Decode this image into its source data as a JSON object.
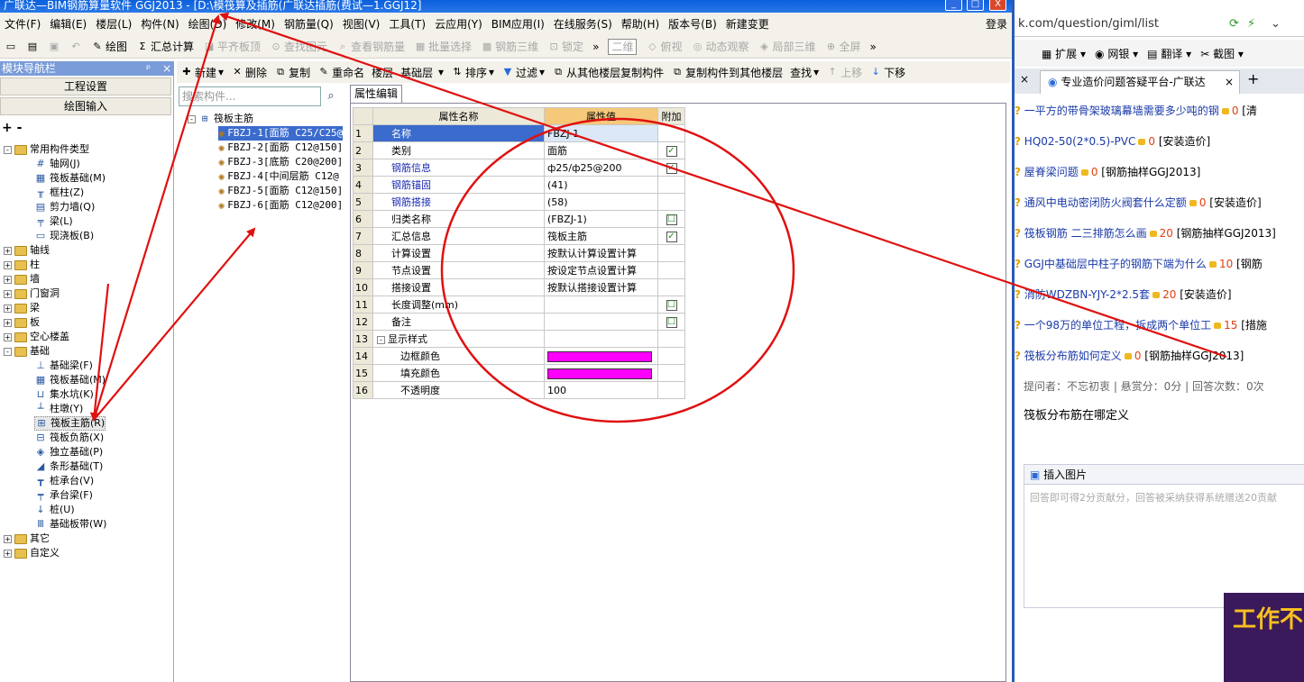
{
  "window": {
    "title": "广联达—BIM钢筋算量软件 GGJ2013 - [D:\\模筏算及插筋(广联达插筋(费试—1.GGJ12]",
    "minimize": "_",
    "maximize": "□",
    "close": "X"
  },
  "menu": [
    "文件(F)",
    "编辑(E)",
    "楼层(L)",
    "构件(N)",
    "绘图(D)",
    "修改(M)",
    "钢筋量(Q)",
    "视图(V)",
    "工具(T)",
    "云应用(Y)",
    "BIM应用(I)",
    "在线服务(S)",
    "帮助(H)",
    "版本号(B)",
    "新建变更"
  ],
  "menu_login": "登录",
  "toolbar1": {
    "draw": "绘图",
    "summary": "汇总计算",
    "flat_board": "平齐板顶",
    "find_elem": "查找图元",
    "view_rebar": "查看钢筋量",
    "batch_select": "批量选择",
    "rebar_3d": "钢筋三维",
    "lock": "锁定",
    "view_mode": "二维",
    "top_view": "俯视",
    "dynamic": "动态观察",
    "local_3d": "局部三维",
    "fullscreen": "全屏"
  },
  "nav": {
    "header": "模块导航栏",
    "pin": "ᵖ",
    "close": "×",
    "btn_project": "工程设置",
    "btn_draw": "绘图输入",
    "tools": "+ -"
  },
  "tree": {
    "common": "常用构件类型",
    "grid": "轴网(J)",
    "raft_found": "筏板基础(M)",
    "column": "框柱(Z)",
    "shear_wall": "剪力墙(Q)",
    "beam": "梁(L)",
    "slab": "现浇板(B)",
    "axis": "轴线",
    "col": "柱",
    "wall": "墙",
    "door": "门窗洞",
    "liang": "梁",
    "ban": "板",
    "hollow": "空心楼盖",
    "foundation": "基础",
    "f_beam": "基础梁(F)",
    "f_raft": "筏板基础(M)",
    "f_pit": "集水坑(K)",
    "f_pier": "柱墩(Y)",
    "f_main": "筏板主筋(R)",
    "f_neg": "筏板负筋(X)",
    "f_indep": "独立基础(P)",
    "f_strip": "条形基础(T)",
    "f_cap": "桩承台(V)",
    "f_capbeam": "承台梁(F)",
    "f_pile": "桩(U)",
    "f_band": "基础板带(W)",
    "other": "其它",
    "custom": "自定义"
  },
  "toolbar2": {
    "new": "新建",
    "delete": "删除",
    "copy": "复制",
    "rename": "重命名",
    "floor_label": "楼层",
    "floor_value": "基础层",
    "sort": "排序",
    "filter": "过滤",
    "copy_from": "从其他楼层复制构件",
    "copy_to": "复制构件到其他楼层",
    "find": "查找",
    "up": "上移",
    "down": "下移"
  },
  "components": {
    "search_placeholder": "搜索构件...",
    "root": "筏板主筋",
    "items": [
      "FBZJ-1[面筋 C25/C25@",
      "FBZJ-2[面筋 C12@150]",
      "FBZJ-3[底筋 C20@200]",
      "FBZJ-4[中间层筋 C12@",
      "FBZJ-5[面筋 C12@150]",
      "FBZJ-6[面筋 C12@200]"
    ]
  },
  "props": {
    "tab": "属性编辑",
    "col_name": "属性名称",
    "col_value": "属性值",
    "col_extra": "附加",
    "rows": [
      {
        "n": "1",
        "name": "名称",
        "value": "FBZJ-1",
        "check": ""
      },
      {
        "n": "2",
        "name": "类别",
        "value": "面筋",
        "check": "✓"
      },
      {
        "n": "3",
        "name": "钢筋信息",
        "value": "ф25/ф25@200",
        "check": "✓"
      },
      {
        "n": "4",
        "name": "钢筋锚固",
        "value": "(41)",
        "check": ""
      },
      {
        "n": "5",
        "name": "钢筋搭接",
        "value": "(58)",
        "check": ""
      },
      {
        "n": "6",
        "name": "归类名称",
        "value": "(FBZJ-1)",
        "check": "☐"
      },
      {
        "n": "7",
        "name": "汇总信息",
        "value": "筏板主筋",
        "check": "✓"
      },
      {
        "n": "8",
        "name": "计算设置",
        "value": "按默认计算设置计算",
        "check": ""
      },
      {
        "n": "9",
        "name": "节点设置",
        "value": "按设定节点设置计算",
        "check": ""
      },
      {
        "n": "10",
        "name": "搭接设置",
        "value": "按默认搭接设置计算",
        "check": ""
      },
      {
        "n": "11",
        "name": "长度调整(mm)",
        "value": "",
        "check": "☐"
      },
      {
        "n": "12",
        "name": "备注",
        "value": "",
        "check": "☐"
      },
      {
        "n": "13",
        "name": "显示样式",
        "value": "",
        "check": ""
      },
      {
        "n": "14",
        "name": "边框颜色",
        "value": "",
        "check": ""
      },
      {
        "n": "15",
        "name": "填充颜色",
        "value": "",
        "check": ""
      },
      {
        "n": "16",
        "name": "不透明度",
        "value": "100",
        "check": ""
      }
    ],
    "swatch_color": "#ff00ff"
  },
  "browser": {
    "address": "k.com/question/giml/list",
    "bookmarks": [
      "扩展",
      "网银",
      "翻译",
      "截图"
    ],
    "tab_title": "专业造价问题答疑平台-广联达",
    "tab_close": "×",
    "new_tab": "+",
    "questions": [
      {
        "title": "一平方的带骨架玻璃幕墙需要多少吨的钢",
        "score": "0",
        "tag": "[清"
      },
      {
        "title": "HQ02-50(2*0.5)-PVC",
        "score": "0",
        "tag": "[安装造价]"
      },
      {
        "title": "屋脊梁问题",
        "score": "0",
        "tag": "[钢筋抽样GGJ2013]"
      },
      {
        "title": "通风中电动密闭防火阀套什么定额",
        "score": "0",
        "tag": "[安装造价]"
      },
      {
        "title": "筏板钢筋 二三排筋怎么画",
        "score": "20",
        "tag": "[钢筋抽样GGJ2013]"
      },
      {
        "title": "GGJ中基础层中柱子的钢筋下端为什么",
        "score": "10",
        "tag": "[钢筋"
      },
      {
        "title": "消防WDZBN-YJY-2*2.5套",
        "score": "20",
        "tag": "[安装造价]"
      },
      {
        "title": "一个98万的单位工程，拆成两个单位工",
        "score": "15",
        "tag": "[措施"
      },
      {
        "title": "筏板分布筋如何定义",
        "score": "0",
        "tag": "[钢筋抽样GGJ2013]"
      }
    ],
    "asker": "提问者：不忘初衷  |  悬赏分：0分  |  回答次数：0次",
    "question_text": "筏板分布筋在哪定义",
    "insert_image": "插入图片",
    "reply_placeholder": "回答即可得2分贡献分，回答被采纳获得系统赠送20贡献",
    "ad_text": "工作不能"
  },
  "annotation_color": "#e01010"
}
